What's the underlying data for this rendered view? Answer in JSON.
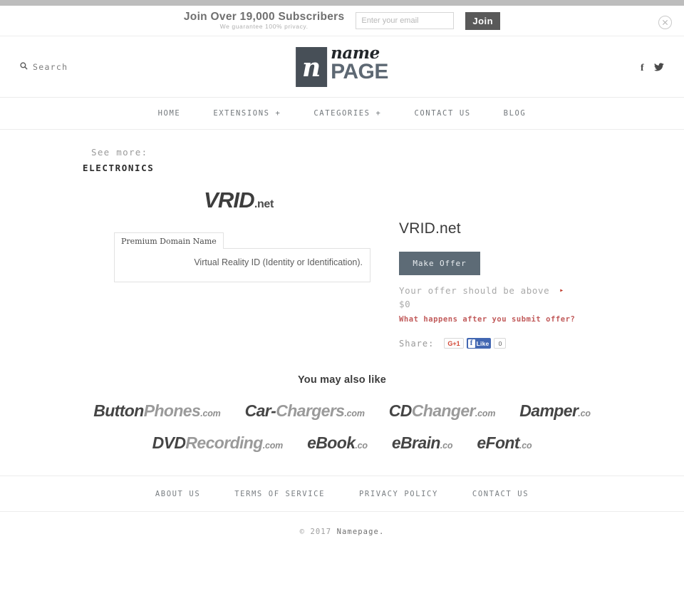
{
  "subscribe_bar": {
    "title": "Join Over 19,000 Subscribers",
    "subtitle": "We guarantee 100% privacy.",
    "email_placeholder": "Enter your email",
    "email_value": "",
    "join_label": "Join",
    "close_icon": "close-circle-icon"
  },
  "header": {
    "search_label": "Search",
    "search_icon": "search-icon",
    "logo": {
      "mark_glyph": "n",
      "name_text": "name",
      "page_text": "PAGE"
    },
    "social": [
      {
        "name": "facebook-icon",
        "label": "f"
      },
      {
        "name": "twitter-icon",
        "label": "t"
      }
    ]
  },
  "nav": {
    "items": [
      {
        "label": "HOME"
      },
      {
        "label": "EXTENSIONS +"
      },
      {
        "label": "CATEGORIES +"
      },
      {
        "label": "CONTACT US"
      },
      {
        "label": "BLOG"
      }
    ]
  },
  "see_more": {
    "label": "See more:",
    "category": "ELECTRONICS"
  },
  "product": {
    "logo_main": "VRID",
    "logo_tld": ".net",
    "tab_label": "Premium Domain Name",
    "description": "Virtual Reality ID (Identity or Identification).",
    "title": "VRID.net",
    "make_offer_label": "Make Offer",
    "offer_note": "Your offer should be above",
    "offer_arrow": "▸",
    "offer_amount": "$0",
    "offer_link": "What happens after you submit offer?",
    "share_label": "Share:",
    "gplus_label": "G+1",
    "fb_f": "f",
    "fb_like_label": "Like",
    "fb_count": "0",
    "accent_color": "#c15a5a",
    "button_color": "#5d6b76"
  },
  "related": {
    "title": "You may also like",
    "rows": [
      [
        {
          "a": "Button",
          "b": "Phones",
          "tld": ".com"
        },
        {
          "a": "Car-",
          "b": "Chargers",
          "tld": ".com"
        },
        {
          "a": "CD",
          "b": "Changer",
          "tld": ".com"
        },
        {
          "a": "Damper",
          "b": "",
          "tld": ".co"
        }
      ],
      [
        {
          "a": "DVD",
          "b": "Recording",
          "tld": ".com"
        },
        {
          "a": "eBook",
          "b": "",
          "tld": ".co"
        },
        {
          "a": "eBrain",
          "b": "",
          "tld": ".co"
        },
        {
          "a": "eFont",
          "b": "",
          "tld": ".co"
        }
      ]
    ]
  },
  "footer": {
    "links": [
      {
        "label": "ABOUT US"
      },
      {
        "label": "TERMS OF SERVICE"
      },
      {
        "label": "PRIVACY POLICY"
      },
      {
        "label": "CONTACT US"
      }
    ],
    "copyright_prefix": "© 2017 ",
    "copyright_name": "Namepage."
  }
}
